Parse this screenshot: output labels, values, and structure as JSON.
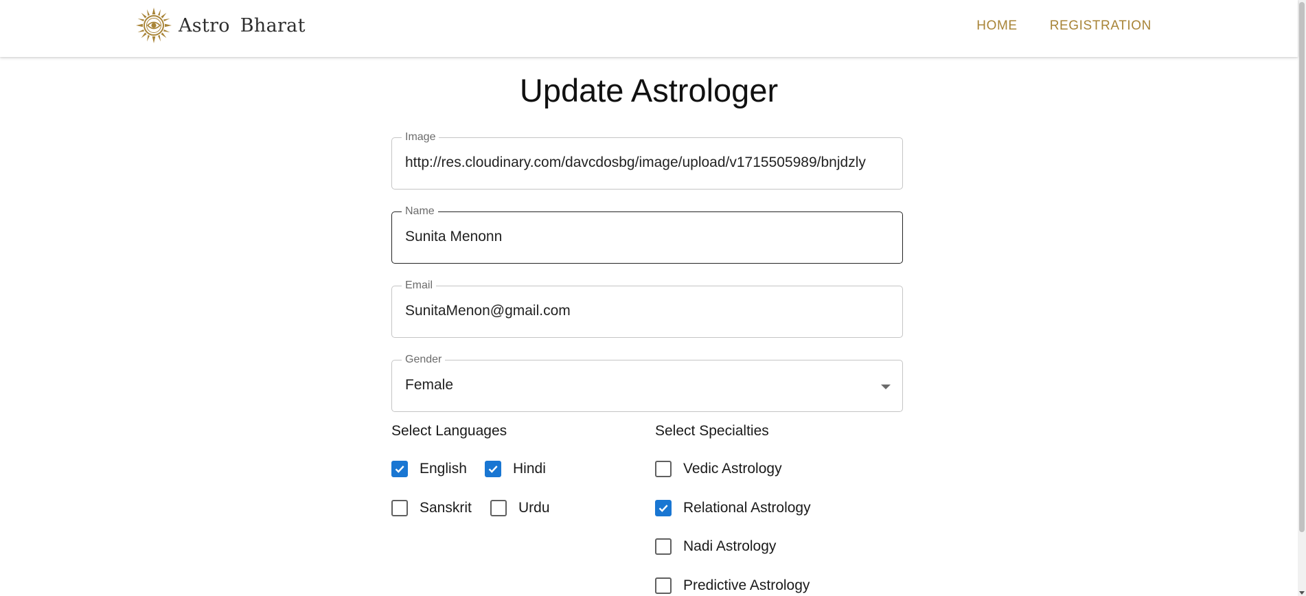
{
  "nav": {
    "brand": "Astro Bharat",
    "links": [
      "HOME",
      "REGISTRATION"
    ]
  },
  "page": {
    "title": "Update Astrologer"
  },
  "form": {
    "image": {
      "label": "Image",
      "value": "http://res.cloudinary.com/davcdosbg/image/upload/v1715505989/bnjdzly"
    },
    "name": {
      "label": "Name",
      "value": "Sunita Menonn"
    },
    "email": {
      "label": "Email",
      "value": "SunitaMenon@gmail.com"
    },
    "gender": {
      "label": "Gender",
      "value": "Female"
    }
  },
  "languages": {
    "title": "Select Languages",
    "items": [
      {
        "label": "English",
        "checked": true
      },
      {
        "label": "Hindi",
        "checked": true
      },
      {
        "label": "Sanskrit",
        "checked": false
      },
      {
        "label": "Urdu",
        "checked": false
      }
    ]
  },
  "specialties": {
    "title": "Select Specialties",
    "items": [
      {
        "label": "Vedic Astrology",
        "checked": false
      },
      {
        "label": "Relational Astrology",
        "checked": true
      },
      {
        "label": "Nadi Astrology",
        "checked": false
      },
      {
        "label": "Predictive Astrology",
        "checked": false
      }
    ]
  },
  "colors": {
    "accent": "#a88437",
    "checkbox": "#1976d2",
    "brand_text": "#2e2e2e"
  },
  "icons": {
    "logo": "sun-eye-logo-icon",
    "checkbox_checked": "check-icon",
    "dropdown": "chevron-down-icon"
  }
}
